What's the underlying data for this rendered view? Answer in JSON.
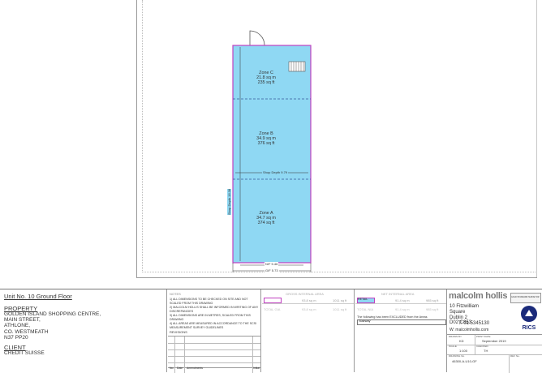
{
  "plan": {
    "zones": [
      {
        "name": "Zone C",
        "sqm": "21.8 sq m",
        "sqft": "235 sq ft"
      },
      {
        "name": "Zone B",
        "sqm": "34.9 sq m",
        "sqft": "376 sq ft"
      },
      {
        "name": "Zone A",
        "sqm": "34.7 sq m",
        "sqft": "374 sq ft"
      }
    ],
    "shop_depth": "Shop Depth 9.79",
    "total_depth": "Shop Depth 16.38",
    "nf_width": "N/F 5.46",
    "gf_width": "G/F 5.73",
    "fill_color": "#8fd8f3",
    "outline_color": "#c040c0"
  },
  "title_block": {
    "unit_title": "Unit No. 10 Ground Floor",
    "property_heading": "PROPERTY",
    "property_lines": [
      "GOLDEN ISLAND SHOPPING CENTRE,",
      "MAIN STREET,",
      "ATHLONE,",
      "CO. WESTMEATH",
      "N37 PP20"
    ],
    "client_heading": "CLIENT",
    "client_name": "CREDIT SUISSE",
    "notes_heading": "NOTES",
    "notes": [
      "1) ALL DIMENSIONS TO BE CHECKED ON SITE AND NOT SCALED FROM THIS DRAWING",
      "2) MALCOLM HOLLIS SHALL BE INFORMED IN WRITING OF ANY DISCREPANCIES",
      "3) ALL DIMENSIONS ARE IN METRES, SCALED FROM THIS DRAWING",
      "4) ALL AREAS ARE MEASURED IN ACCORDANCE TO THE SCSI MEASUREMENT SURVEY GUIDELINES"
    ],
    "revisions_heading": "REVISIONS",
    "revision_cols": [
      "No.",
      "Date",
      "Amendments",
      "Initial"
    ],
    "gia_heading": "GROSS INTERNAL AREA",
    "gia_rows": [
      {
        "label": "",
        "sqm": "93.8 sq m",
        "sqft": "1011 sq ft"
      },
      {
        "label": "TOTAL GIA",
        "sqm": "93.8 sq m",
        "sqft": "1011 sq ft"
      }
    ],
    "nia_heading": "NET INTERNAL AREA",
    "nia_rows": [
      {
        "label": "RETAIL",
        "sqm": "91.4 sq m",
        "sqft": "985 sq ft"
      },
      {
        "label": "TOTAL NIA",
        "sqm": "91.4 sq m",
        "sqft": "985 sq ft"
      }
    ],
    "excluded_note": "The following has been EXCLUDED from the Areas",
    "excluded_row": {
      "label": "Stairway",
      "sqm": "",
      "sqft": ""
    },
    "company_name": "malcolm hollis",
    "address_lines": [
      "10 Fitzwilliam",
      "Square",
      "Dublin 2",
      "D02 C853"
    ],
    "phone": "T: 01 5345130",
    "web": "W: malcolmhollis.com",
    "rics": "RICS",
    "award_text": "GOLD STANDARD SURVEYOR",
    "drawn_by_label": "DRAWN BY",
    "drawn_by": "KD",
    "date_label": "PRINT DATE",
    "date": "September 2019",
    "scale_label": "SCALE",
    "scale": "1:100",
    "checked_label": "CHECKED",
    "checked": "TH",
    "drawing_no_label": "DRAWING No.",
    "drawing_no": "46300-A-U10-GF",
    "rev_label": "REV No.",
    "rev": ""
  }
}
